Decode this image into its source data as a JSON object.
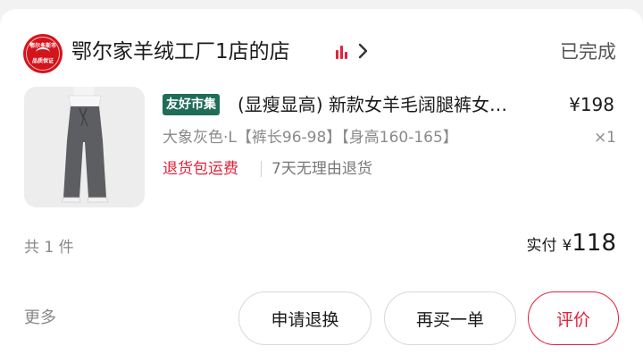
{
  "shop": {
    "logo_line1": "鄂尔多斯市",
    "logo_line2": "品质保证",
    "name": "鄂尔家羊绒工厂1店的店",
    "status": "已完成"
  },
  "product": {
    "tag": "友好市集",
    "title": "(显瘦显高) 新款女羊毛阔腿裤女…",
    "price": "¥198",
    "sku": "大象灰色·L【裤长96-98】【身高160-165】",
    "quantity": "×1",
    "service_return_shipping": "退货包运费",
    "service_no_reason": "7天无理由退货"
  },
  "summary": {
    "count": "共 1 件",
    "paid_label": "实付",
    "currency": "¥",
    "paid_amount": "118"
  },
  "actions": {
    "more": "更多",
    "exchange": "申请退换",
    "rebuy": "再买一单",
    "review": "评价"
  },
  "colors": {
    "accent": "#e0223a",
    "tag_bg": "#1f6d57",
    "logo_red": "#d4141c"
  }
}
